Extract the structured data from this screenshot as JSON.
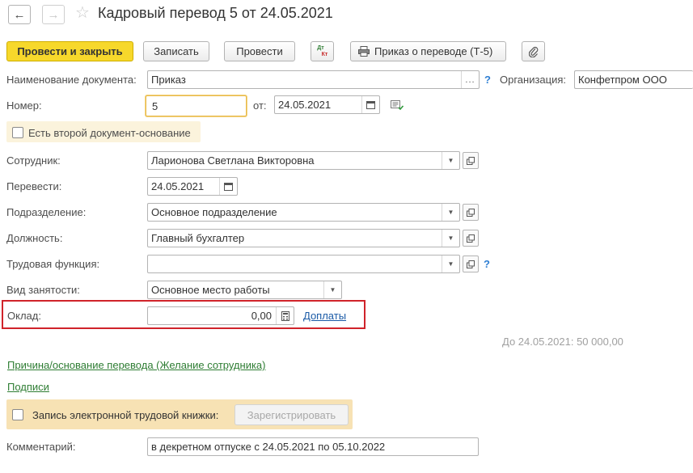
{
  "header": {
    "back_icon": "arrow-left-icon",
    "forward_icon": "arrow-right-icon",
    "favorite_icon": "star-icon",
    "title": "Кадровый перевод 5 от 24.05.2021"
  },
  "toolbar": {
    "post_close_label": "Провести и закрыть",
    "save_label": "Записать",
    "post_label": "Провести",
    "dt_kt_label_top": "Дт",
    "dt_kt_label_bottom": "Кт",
    "print_label": "Приказ о переводе (Т-5)",
    "print_icon": "printer-icon",
    "attach_icon": "paperclip-icon"
  },
  "form": {
    "doc_name_label": "Наименование документа:",
    "doc_name_value": "Приказ",
    "org_label": "Организация:",
    "org_value": "Конфетпром ООО",
    "number_label": "Номер:",
    "number_value": "5",
    "date_from_label": "от:",
    "date_value": "24.05.2021",
    "second_doc_label": "Есть второй документ-основание",
    "employee_label": "Сотрудник:",
    "employee_value": "Ларионова Светлана Викторовна",
    "transfer_label": "Перевести:",
    "transfer_date": "24.05.2021",
    "department_label": "Подразделение:",
    "department_value": "Основное подразделение",
    "position_label": "Должность:",
    "position_value": "Главный бухгалтер",
    "labor_function_label": "Трудовая функция:",
    "labor_function_value": "",
    "employment_type_label": "Вид занятости:",
    "employment_type_value": "Основное место работы",
    "salary_label": "Оклад:",
    "salary_value": "0,00",
    "allowances_link": "Доплаты",
    "previous_salary": "До 24.05.2021: 50 000,00",
    "reason_link": "Причина/основание перевода (Желание сотрудника)",
    "signatures_link": "Подписи",
    "etk_label": "Запись электронной трудовой книжки:",
    "register_button": "Зарегистрировать",
    "comment_label": "Комментарий:",
    "comment_value": "в декретном отпуске с 24.05.2021 по 05.10.2022",
    "help_mark": "?"
  }
}
